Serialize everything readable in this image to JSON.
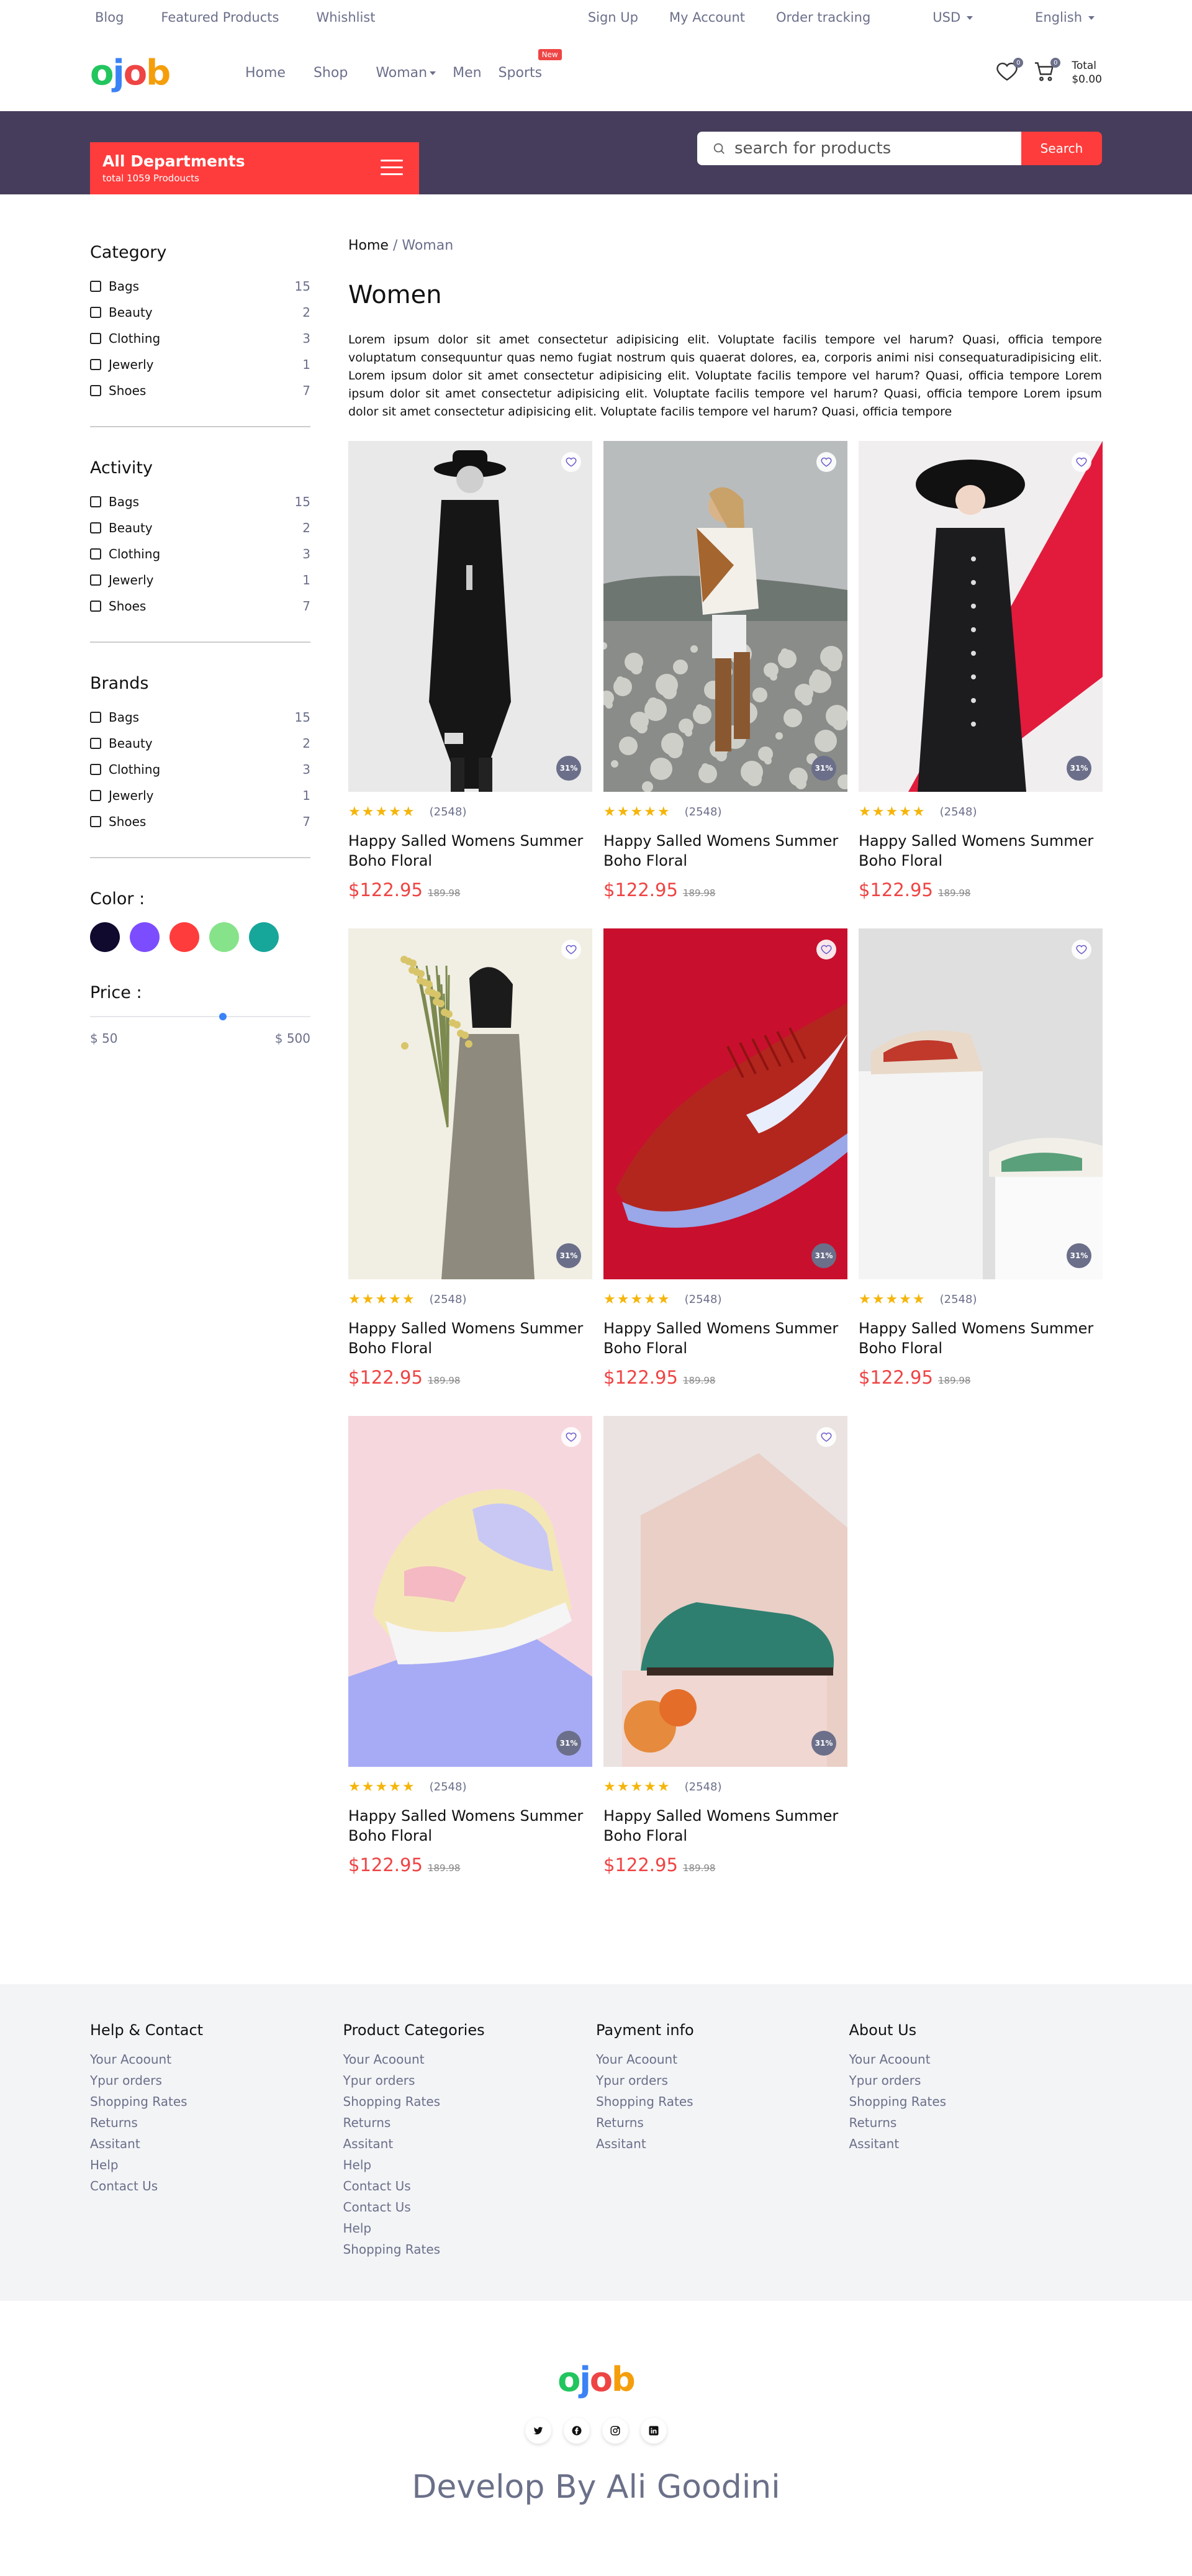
{
  "topbar": {
    "left": [
      "Blog",
      "Featured Products",
      "Whishlist"
    ],
    "right": [
      "Sign Up",
      "My Account",
      "Order tracking"
    ],
    "currency": "USD",
    "language": "English"
  },
  "header": {
    "logo": [
      "o",
      "j",
      "o",
      "b"
    ],
    "nav": [
      "Home",
      "Shop",
      "Woman",
      "Men",
      "Sports"
    ],
    "new_badge": "New",
    "wishlist_count": "0",
    "cart_count": "0",
    "cart_total_label": "Total",
    "cart_total_value": "$0.00"
  },
  "departments": {
    "title": "All Departments",
    "subtitle": "total 1059 Prodoucts"
  },
  "search": {
    "placeholder": "search for products",
    "button": "Search"
  },
  "sidebar": {
    "groups": [
      {
        "title": "Category",
        "items": [
          [
            "Bags",
            "15"
          ],
          [
            "Beauty",
            "2"
          ],
          [
            "Clothing",
            "3"
          ],
          [
            "Jewerly",
            "1"
          ],
          [
            "Shoes",
            "7"
          ]
        ]
      },
      {
        "title": "Activity",
        "items": [
          [
            "Bags",
            "15"
          ],
          [
            "Beauty",
            "2"
          ],
          [
            "Clothing",
            "3"
          ],
          [
            "Jewerly",
            "1"
          ],
          [
            "Shoes",
            "7"
          ]
        ]
      },
      {
        "title": "Brands",
        "items": [
          [
            "Bags",
            "15"
          ],
          [
            "Beauty",
            "2"
          ],
          [
            "Clothing",
            "3"
          ],
          [
            "Jewerly",
            "1"
          ],
          [
            "Shoes",
            "7"
          ]
        ]
      }
    ],
    "color_label": "Color :",
    "colors": [
      "#0f0a2e",
      "#7c4dff",
      "#ff3c3c",
      "#86e38a",
      "#17a69a"
    ],
    "price_label": "Price :",
    "price_min": "$ 50",
    "price_max": "$ 500"
  },
  "main": {
    "breadcrumb_home": "Home",
    "breadcrumb_sep": " / ",
    "breadcrumb_current": "Woman",
    "title": "Women",
    "description": "Lorem ipsum dolor sit amet consectetur adipisicing elit. Voluptate facilis tempore vel harum? Quasi, officia tempore voluptatum consequuntur quas nemo fugiat nostrum quis quaerat dolores, ea, corporis animi nisi consequaturadipisicing elit. Lorem ipsum dolor sit amet consectetur adipisicing elit. Voluptate facilis tempore vel harum? Quasi, officia tempore Lorem ipsum dolor sit amet consectetur adipisicing elit. Voluptate facilis tempore vel harum? Quasi, officia tempore Lorem ipsum dolor sit amet consectetur adipisicing elit. Voluptate facilis tempore vel harum? Quasi, officia tempore"
  },
  "products": [
    {
      "name": "Happy Salled Womens Summer Boho Floral",
      "reviews": "(2548)",
      "price": "$122.95",
      "old_price": "189.98",
      "discount": "31%",
      "stars": "★★★★★"
    },
    {
      "name": "Happy Salled Womens Summer Boho Floral",
      "reviews": "(2548)",
      "price": "$122.95",
      "old_price": "189.98",
      "discount": "31%",
      "stars": "★★★★★"
    },
    {
      "name": "Happy Salled Womens Summer Boho Floral",
      "reviews": "(2548)",
      "price": "$122.95",
      "old_price": "189.98",
      "discount": "31%",
      "stars": "★★★★★"
    },
    {
      "name": "Happy Salled Womens Summer Boho Floral",
      "reviews": "(2548)",
      "price": "$122.95",
      "old_price": "189.98",
      "discount": "31%",
      "stars": "★★★★★"
    },
    {
      "name": "Happy Salled Womens Summer Boho Floral",
      "reviews": "(2548)",
      "price": "$122.95",
      "old_price": "189.98",
      "discount": "31%",
      "stars": "★★★★★"
    },
    {
      "name": "Happy Salled Womens Summer Boho Floral",
      "reviews": "(2548)",
      "price": "$122.95",
      "old_price": "189.98",
      "discount": "31%",
      "stars": "★★★★★"
    },
    {
      "name": "Happy Salled Womens Summer Boho Floral",
      "reviews": "(2548)",
      "price": "$122.95",
      "old_price": "189.98",
      "discount": "31%",
      "stars": "★★★★★"
    },
    {
      "name": "Happy Salled Womens Summer Boho Floral",
      "reviews": "(2548)",
      "price": "$122.95",
      "old_price": "189.98",
      "discount": "31%",
      "stars": "★★★★★"
    }
  ],
  "footer": {
    "cols": [
      {
        "title": "Help & Contact",
        "links": [
          "Your Acoount",
          "Ypur orders",
          "Shopping Rates",
          "Returns",
          "Assitant",
          "Help",
          "Contact Us"
        ]
      },
      {
        "title": "Product Categories",
        "links": [
          "Your Acoount",
          "Ypur orders",
          "Shopping Rates",
          "Returns",
          "Assitant",
          "Help",
          "Contact Us",
          "Contact Us",
          "Help",
          "Shopping Rates"
        ]
      },
      {
        "title": "Payment info",
        "links": [
          "Your Acoount",
          "Ypur orders",
          "Shopping Rates",
          "Returns",
          "Assitant"
        ]
      },
      {
        "title": "About Us",
        "links": [
          "Your Acoount",
          "Ypur orders",
          "Shopping Rates",
          "Returns",
          "Assitant"
        ]
      }
    ],
    "credit": "Develop By Ali Goodini",
    "socials": [
      "twitter-icon",
      "facebook-icon",
      "instagram-icon",
      "linkedin-icon"
    ]
  }
}
